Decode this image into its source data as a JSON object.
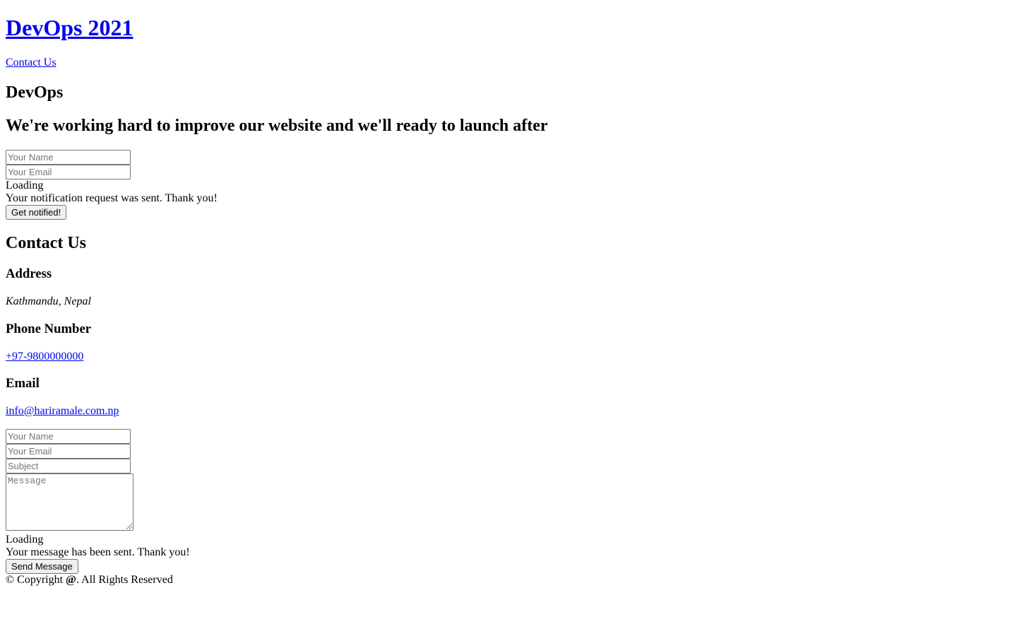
{
  "header": {
    "site_title": "DevOps 2021",
    "nav": [
      "Contact Us"
    ]
  },
  "hero": {
    "title": "DevOps",
    "subtitle": "We're working hard to improve our website and we'll ready to launch after"
  },
  "notify_form": {
    "name_placeholder": "Your Name",
    "email_placeholder": "Your Email",
    "loading_text": "Loading",
    "sent_message": "Your notification request was sent. Thank you!",
    "submit_label": "Get notified!"
  },
  "contact": {
    "title": "Contact Us",
    "address_heading": "Address",
    "address": "Kathmandu, Nepal",
    "phone_heading": "Phone Number",
    "phone": "+97-9800000000",
    "email_heading": "Email",
    "email": "info@hariramale.com.np"
  },
  "contact_form": {
    "name_placeholder": "Your Name",
    "email_placeholder": "Your Email",
    "subject_placeholder": "Subject",
    "message_placeholder": "Message",
    "loading_text": "Loading",
    "sent_message": "Your message has been sent. Thank you!",
    "submit_label": "Send Message"
  },
  "footer": {
    "copyright_prefix": "© Copyright ",
    "copyright_at": "@",
    "copyright_suffix": ". All Rights Reserved"
  }
}
